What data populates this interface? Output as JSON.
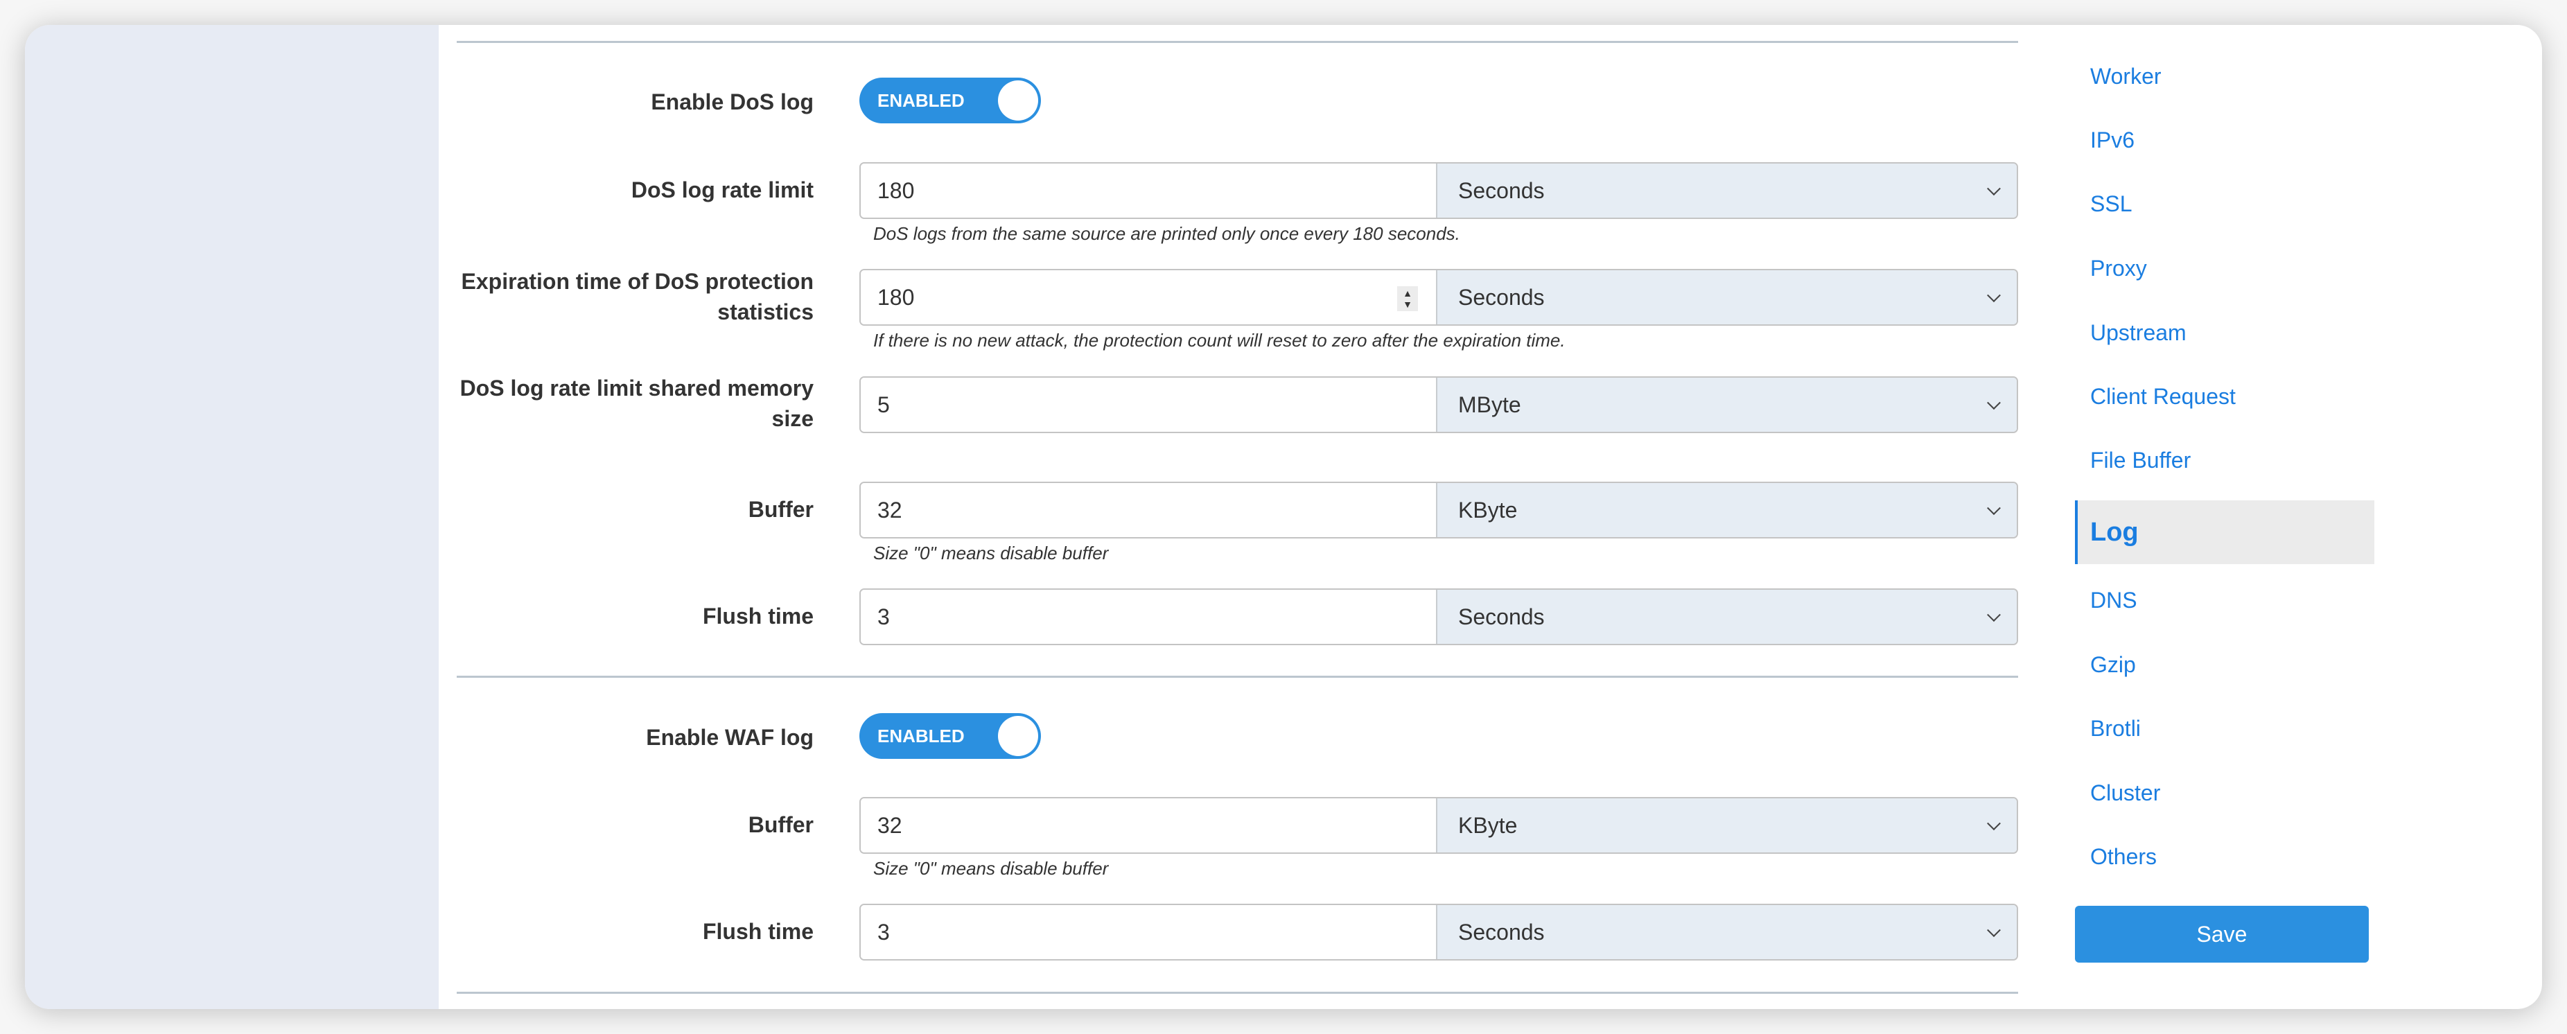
{
  "dos_section": {
    "enable": {
      "label": "Enable DoS log",
      "toggle_text": "ENABLED",
      "enabled": true
    },
    "rate_limit": {
      "label": "DoS log rate limit",
      "value": "180",
      "unit": "Seconds",
      "help": "DoS logs from the same source are printed only once every 180 seconds."
    },
    "expiration": {
      "label": "Expiration time of DoS protection statistics",
      "value": "180",
      "unit": "Seconds",
      "help": "If there is no new attack, the protection count will reset to zero after the expiration time."
    },
    "shared_memory": {
      "label": "DoS log rate limit shared memory size",
      "value": "5",
      "unit": "MByte"
    },
    "buffer": {
      "label": "Buffer",
      "value": "32",
      "unit": "KByte",
      "help": "Size \"0\" means disable buffer"
    },
    "flush_time": {
      "label": "Flush time",
      "value": "3",
      "unit": "Seconds"
    }
  },
  "waf_section": {
    "enable": {
      "label": "Enable WAF log",
      "toggle_text": "ENABLED",
      "enabled": true
    },
    "buffer": {
      "label": "Buffer",
      "value": "32",
      "unit": "KByte",
      "help": "Size \"0\" means disable buffer"
    },
    "flush_time": {
      "label": "Flush time",
      "value": "3",
      "unit": "Seconds"
    }
  },
  "nav": {
    "items": [
      {
        "label": "Worker"
      },
      {
        "label": "IPv6"
      },
      {
        "label": "SSL"
      },
      {
        "label": "Proxy"
      },
      {
        "label": "Upstream"
      },
      {
        "label": "Client Request"
      },
      {
        "label": "File Buffer"
      },
      {
        "label": "Log",
        "active": true
      },
      {
        "label": "DNS"
      },
      {
        "label": "Gzip"
      },
      {
        "label": "Brotli"
      },
      {
        "label": "Cluster"
      },
      {
        "label": "Others"
      }
    ],
    "save_label": "Save"
  },
  "colors": {
    "accent": "#2b90e0",
    "link": "#1a7de0",
    "left_panel": "#e7ebf4",
    "select_bg": "#e6edf4"
  }
}
